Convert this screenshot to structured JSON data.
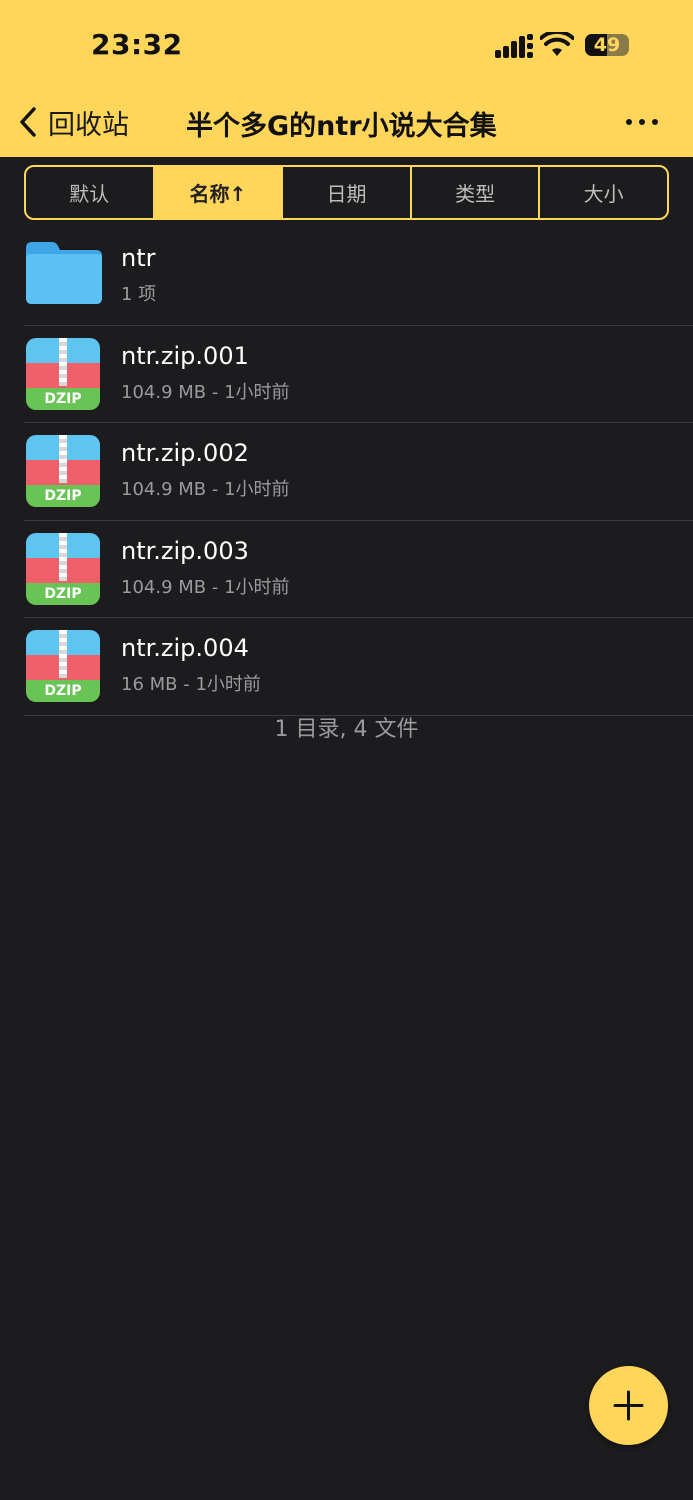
{
  "status": {
    "time": "23:32",
    "battery": "49",
    "battery_level": 0.49
  },
  "nav": {
    "back_label": "回收站",
    "title": "半个多G的ntr小说大合集"
  },
  "sort_tabs": [
    {
      "label": "默认",
      "active": false
    },
    {
      "label": "名称↑",
      "active": true
    },
    {
      "label": "日期",
      "active": false
    },
    {
      "label": "类型",
      "active": false
    },
    {
      "label": "大小",
      "active": false
    }
  ],
  "items": [
    {
      "type": "folder",
      "icon": "folder-icon",
      "name": "ntr",
      "meta": "1 项"
    },
    {
      "type": "zip",
      "icon": "dzip-icon",
      "icon_label": "DZIP",
      "name": "ntr.zip.001",
      "meta": "104.9 MB - 1小时前"
    },
    {
      "type": "zip",
      "icon": "dzip-icon",
      "icon_label": "DZIP",
      "name": "ntr.zip.002",
      "meta": "104.9 MB - 1小时前"
    },
    {
      "type": "zip",
      "icon": "dzip-icon",
      "icon_label": "DZIP",
      "name": "ntr.zip.003",
      "meta": "104.9 MB - 1小时前"
    },
    {
      "type": "zip",
      "icon": "dzip-icon",
      "icon_label": "DZIP",
      "name": "ntr.zip.004",
      "meta": "16 MB - 1小时前"
    }
  ],
  "summary": "1 目录, 4 文件",
  "colors": {
    "accent": "#ffd55a",
    "background": "#1c1b1d",
    "folder": "#4fb6f0",
    "zip_top": "#5ec4f0",
    "zip_middle": "#f0606a",
    "zip_bottom": "#68c454"
  }
}
